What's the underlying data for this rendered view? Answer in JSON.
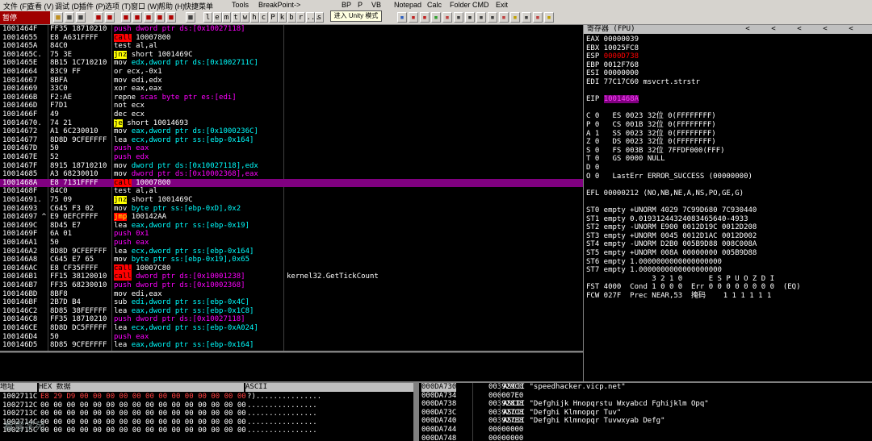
{
  "menu": [
    "文件 (F)",
    "查看 (V)",
    "调试 (D)",
    "插件 (P)",
    "选项 (T)",
    "窗口 (W)",
    "帮助 (H)",
    "快捷菜单",
    "Tools",
    "BreakPoint->",
    "BP",
    "P",
    "VB",
    "Notepad",
    "Calc",
    "Folder",
    "CMD",
    "Exit"
  ],
  "status": "暂停",
  "tooltip": "进入 Unity 模式",
  "toolbar_letters": [
    "l",
    "e",
    "m",
    "t",
    "w",
    "h",
    "c",
    "P",
    "k",
    "b",
    "r",
    "...",
    "s"
  ],
  "cpu_rows": [
    {
      "addr": "1001464F",
      "hex": "FF35 18710210",
      "mn": "push",
      "ops": "dword ptr ds:[0x10027118]",
      "style": "push-mem"
    },
    {
      "addr": "10014655",
      "hex": "E8 A631FFFF",
      "mn": "call",
      "ops": "10007800",
      "style": "call"
    },
    {
      "addr": "1001465A",
      "hex": "84C0",
      "mn": "test",
      "ops": "al,al",
      "style": "plain"
    },
    {
      "addr": "1001465C.",
      "hex": "75 3E",
      "mn": "jnz",
      "ops": "short 1001469C",
      "style": "jmp"
    },
    {
      "addr": "1001465E",
      "hex": "8B15 1C710210",
      "mn": "mov",
      "ops": "edx,dword ptr ds:[0x1002711C]",
      "style": "mem"
    },
    {
      "addr": "10014664",
      "hex": "83C9 FF",
      "mn": "or",
      "ops": "ecx,-0x1",
      "style": "plain"
    },
    {
      "addr": "10014667",
      "hex": "8BFA",
      "mn": "mov",
      "ops": "edi,edx",
      "style": "plain"
    },
    {
      "addr": "10014669",
      "hex": "33C0",
      "mn": "xor",
      "ops": "eax,eax",
      "style": "plain"
    },
    {
      "addr": "1001466B",
      "hex": "F2:AE",
      "mn": "repne",
      "ops": "scas byte ptr es:[edi]",
      "style": "mem2"
    },
    {
      "addr": "1001466D",
      "hex": "F7D1",
      "mn": "not",
      "ops": "ecx",
      "style": "plain"
    },
    {
      "addr": "1001466F",
      "hex": "49",
      "mn": "dec",
      "ops": "ecx",
      "style": "plain"
    },
    {
      "addr": "10014670.",
      "hex": "74 21",
      "mn": "je",
      "ops": "short 10014693",
      "style": "jmp"
    },
    {
      "addr": "10014672",
      "hex": "A1 6C230010",
      "mn": "mov",
      "ops": "eax,dword ptr ds:[0x1000236C]",
      "style": "mem"
    },
    {
      "addr": "10014677",
      "hex": "8D8D 9CFEFFFF",
      "mn": "lea",
      "ops": "ecx,dword ptr ss:[ebp-0x164]",
      "style": "mem"
    },
    {
      "addr": "1001467D",
      "hex": "50",
      "mn": "push",
      "ops": "eax",
      "style": "push"
    },
    {
      "addr": "1001467E",
      "hex": "52",
      "mn": "push",
      "ops": "edx",
      "style": "push"
    },
    {
      "addr": "1001467F",
      "hex": "8915 18710210",
      "mn": "mov",
      "ops": "dword ptr ds:[0x10027118],edx",
      "style": "mem"
    },
    {
      "addr": "10014685",
      "hex": "A3 68230010",
      "mn": "mov",
      "ops": "dword ptr ds:[0x10002368],eax",
      "style": "mem2"
    },
    {
      "addr": "1001468A",
      "hex": "E8 7131FFFF",
      "mn": "call",
      "ops": "10007800",
      "style": "call",
      "selected": true
    },
    {
      "addr": "1001468F",
      "hex": "84C0",
      "mn": "test",
      "ops": "al,al",
      "style": "plain"
    },
    {
      "addr": "10014691.",
      "hex": "75 09",
      "mn": "jnz",
      "ops": "short 1001469C",
      "style": "jmp"
    },
    {
      "addr": "10014693",
      "hex": "C645 F3 02",
      "mn": "mov",
      "ops": "byte ptr ss:[ebp-0xD],0x2",
      "style": "mem"
    },
    {
      "addr": "10014697 ^",
      "hex": "E9 0EFCFFFF",
      "mn": "jmp",
      "ops": "100142AA",
      "style": "jmp-red"
    },
    {
      "addr": "1001469C",
      "hex": "8D45 E7",
      "mn": "lea",
      "ops": "eax,dword ptr ss:[ebp-0x19]",
      "style": "mem"
    },
    {
      "addr": "1001469F",
      "hex": "6A 01",
      "mn": "push",
      "ops": "0x1",
      "style": "push"
    },
    {
      "addr": "100146A1",
      "hex": "50",
      "mn": "push",
      "ops": "eax",
      "style": "push"
    },
    {
      "addr": "100146A2",
      "hex": "8D8D 9CFEFFFF",
      "mn": "lea",
      "ops": "ecx,dword ptr ss:[ebp-0x164]",
      "style": "mem"
    },
    {
      "addr": "100146A8",
      "hex": "C645 E7 65",
      "mn": "mov",
      "ops": "byte ptr ss:[ebp-0x19],0x65",
      "style": "mem"
    },
    {
      "addr": "100146AC",
      "hex": "E8 CF35FFFF",
      "mn": "call",
      "ops": "10007C80",
      "style": "call"
    },
    {
      "addr": "100146B1",
      "hex": "FF15 38120010",
      "mn": "call",
      "ops": "dword ptr ds:[0x10001238]",
      "style": "call-mem",
      "comment": "kernel32.GetTickCount"
    },
    {
      "addr": "100146B7",
      "hex": "FF35 68230010",
      "mn": "push",
      "ops": "dword ptr ds:[0x10002368]",
      "style": "push-mem"
    },
    {
      "addr": "100146BD",
      "hex": "8BF8",
      "mn": "mov",
      "ops": "edi,eax",
      "style": "plain"
    },
    {
      "addr": "100146BF",
      "hex": "2B7D B4",
      "mn": "sub",
      "ops": "edi,dword ptr ss:[ebp-0x4C]",
      "style": "mem"
    },
    {
      "addr": "100146C2",
      "hex": "8D85 38FEFFFF",
      "mn": "lea",
      "ops": "eax,dword ptr ss:[ebp-0x1C8]",
      "style": "mem"
    },
    {
      "addr": "100146C8",
      "hex": "FF35 18710210",
      "mn": "push",
      "ops": "dword ptr ds:[0x10027118]",
      "style": "push-mem"
    },
    {
      "addr": "100146CE",
      "hex": "8D8D DC5FFFFF",
      "mn": "lea",
      "ops": "ecx,dword ptr ss:[ebp-0xA024]",
      "style": "mem"
    },
    {
      "addr": "100146D4",
      "hex": "50",
      "mn": "push",
      "ops": "eax",
      "style": "push"
    },
    {
      "addr": "100146D5",
      "hex": "8D85 9CFEFFFF",
      "mn": "lea",
      "ops": "eax,dword ptr ss:[ebp-0x164]",
      "style": "mem"
    }
  ],
  "regs_title": "寄存器 (FPU)",
  "regs": [
    "EAX 00000039",
    "EBX 10025FC8",
    "ESP 0000D738",
    "EBP 0012F768",
    "ESI 00000000",
    "EDI 77C17C60 msvcrt.strstr",
    "",
    "EIP 1001468A",
    "",
    "C 0   ES 0023 32位 0(FFFFFFFF)",
    "P 0   CS 001B 32位 0(FFFFFFFF)",
    "A 1   SS 0023 32位 0(FFFFFFFF)",
    "Z 0   DS 0023 32位 0(FFFFFFFF)",
    "S 0   FS 003B 32位 7FFDF000(FFF)",
    "T 0   GS 0000 NULL",
    "D 0",
    "O 0   LastErr ERROR_SUCCESS (00000000)",
    "",
    "EFL 00000212 (NO,NB,NE,A,NS,PO,GE,G)",
    "",
    "ST0 empty +UNORM 4029 7C99D680 7C930440",
    "ST1 empty 0.01931244324083465640-4933",
    "ST2 empty -UNORM E900 0012D19C 0012D208",
    "ST3 empty +UNORM 0045 0012D1AC 0012D002",
    "ST4 empty -UNORM D2B0 005B9D88 008C008A",
    "ST5 empty +UNORM 008A 00000000 005B9D88",
    "ST6 empty 1.0000000000000000000",
    "ST7 empty 1.0000000000000000000",
    "               3 2 1 0      E S P U O Z D I",
    "FST 4000  Cond 1 0 0 0  Err 0 0 0 0 0 0 0 0  (EQ)",
    "FCW 027F  Prec NEAR,53  掩码    1 1 1 1 1 1"
  ],
  "dump_headers": {
    "addr": "地址",
    "hex": "HEX 数据",
    "ascii": "ASCII"
  },
  "dump_rows": [
    {
      "addr": "1002711C",
      "hex": "E8 29 D9 00 00 00 00 00 00 00 00 00 00 00 00 00",
      "ascii": "?)..............."
    },
    {
      "addr": "1002712C",
      "hex": "00 00 00 00 00 00 00 00 00 00 00 00 00 00 00 00",
      "ascii": "................"
    },
    {
      "addr": "1002713C",
      "hex": "00 00 00 00 00 00 00 00 00 00 00 00 00 00 00 00",
      "ascii": "................"
    },
    {
      "addr": "1002714C",
      "hex": "00 00 00 00 00 00 00 00 00 00 00 00 00 00 00 00",
      "ascii": "................"
    },
    {
      "addr": "1002715C",
      "hex": "00 00 00 00 00 00 00 00 00 00 00 00 00 00 00 00",
      "ascii": "................"
    }
  ],
  "stack_rows": [
    {
      "addr": "000DA730",
      "val": "003929C0",
      "cmt": "ASCII \"speedhacker.vicp.net\"",
      "sel": true
    },
    {
      "addr": "000DA734",
      "val": "000007E0",
      "cmt": ""
    },
    {
      "addr": "000DA738",
      "val": "00392818",
      "cmt": "ASCII \"Defghijk Hnopqrstu Wxyabcd Fghijklm Opq\""
    },
    {
      "addr": "000DA73C",
      "val": "003927C8",
      "cmt": "ASCII \"Defghi Klmnopqr Tuv\""
    },
    {
      "addr": "000DA740",
      "val": "003927E8",
      "cmt": "ASCII \"Defghi Klmnopqr Tuvwxyab Defg\""
    },
    {
      "addr": "000DA744",
      "val": "00000000",
      "cmt": ""
    },
    {
      "addr": "000DA748",
      "val": "00000000",
      "cmt": ""
    }
  ],
  "watermark": "看雪学苑"
}
